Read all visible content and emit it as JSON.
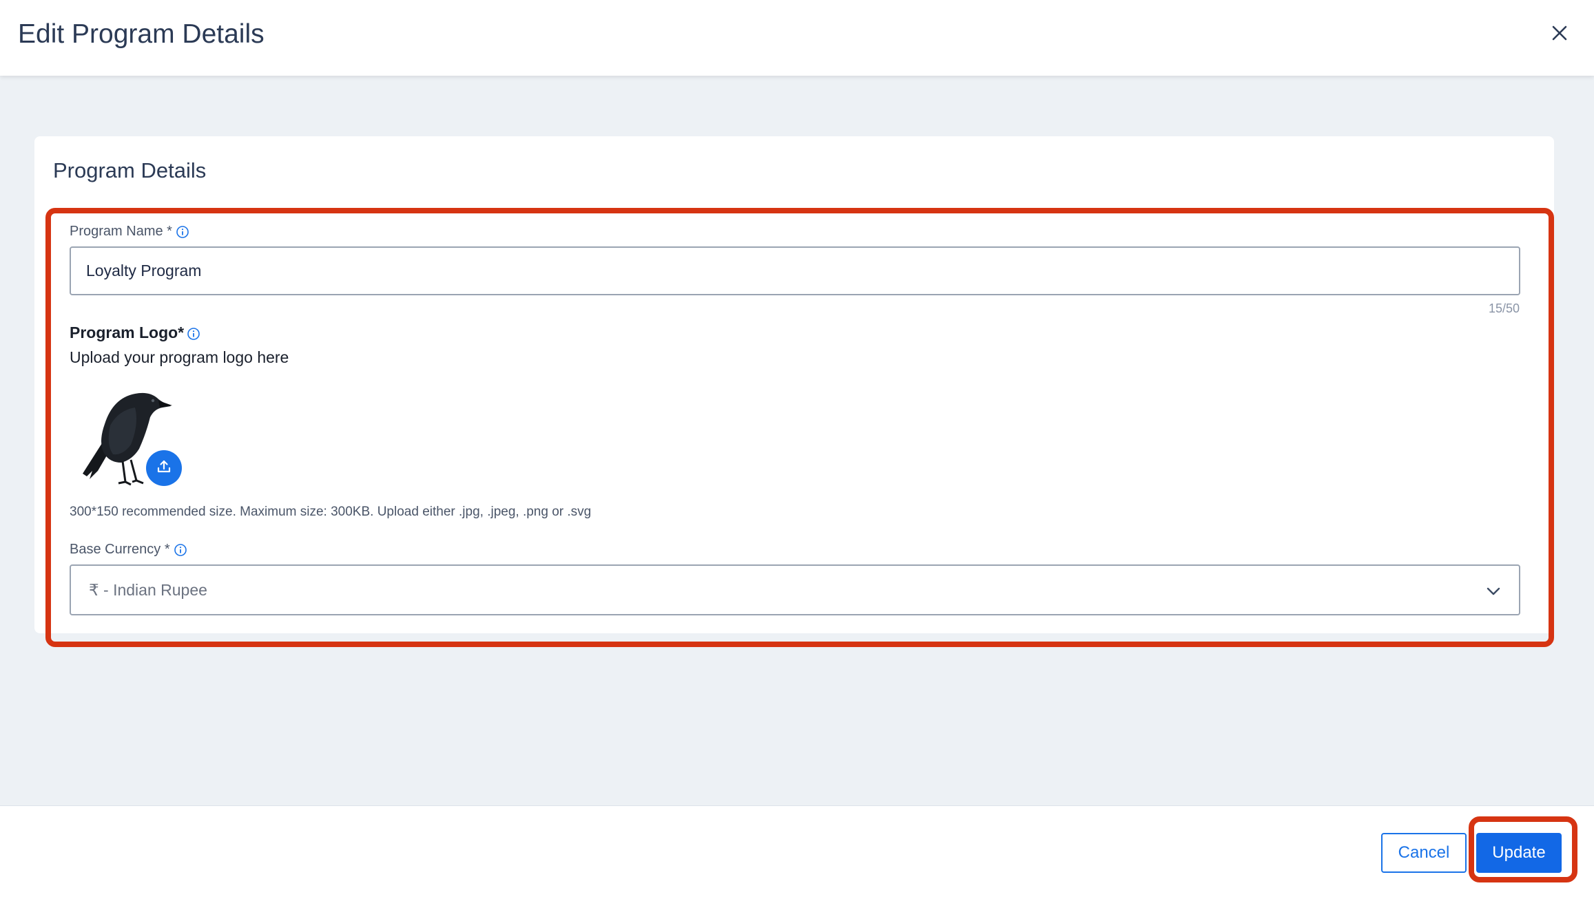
{
  "header": {
    "title": "Edit Program Details",
    "close_icon": "close-icon"
  },
  "card": {
    "title": "Program Details"
  },
  "program_name": {
    "label": "Program Name *",
    "value": "Loyalty Program",
    "counter": "15/50",
    "info_icon": "info-icon"
  },
  "program_logo": {
    "label": "Program Logo*",
    "subtitle": "Upload your program logo here",
    "image": "crow-logo",
    "upload_icon": "upload-icon",
    "hint": "300*150 recommended size. Maximum size: 300KB. Upload either .jpg, .jpeg, .png or .svg"
  },
  "base_currency": {
    "label": "Base Currency *",
    "value": "₹ - Indian Rupee",
    "chevron_icon": "chevron-down-icon"
  },
  "footer": {
    "cancel_label": "Cancel",
    "update_label": "Update"
  },
  "colors": {
    "accent": "#1a73e8",
    "highlight": "#d63412",
    "background": "#edf1f5"
  }
}
